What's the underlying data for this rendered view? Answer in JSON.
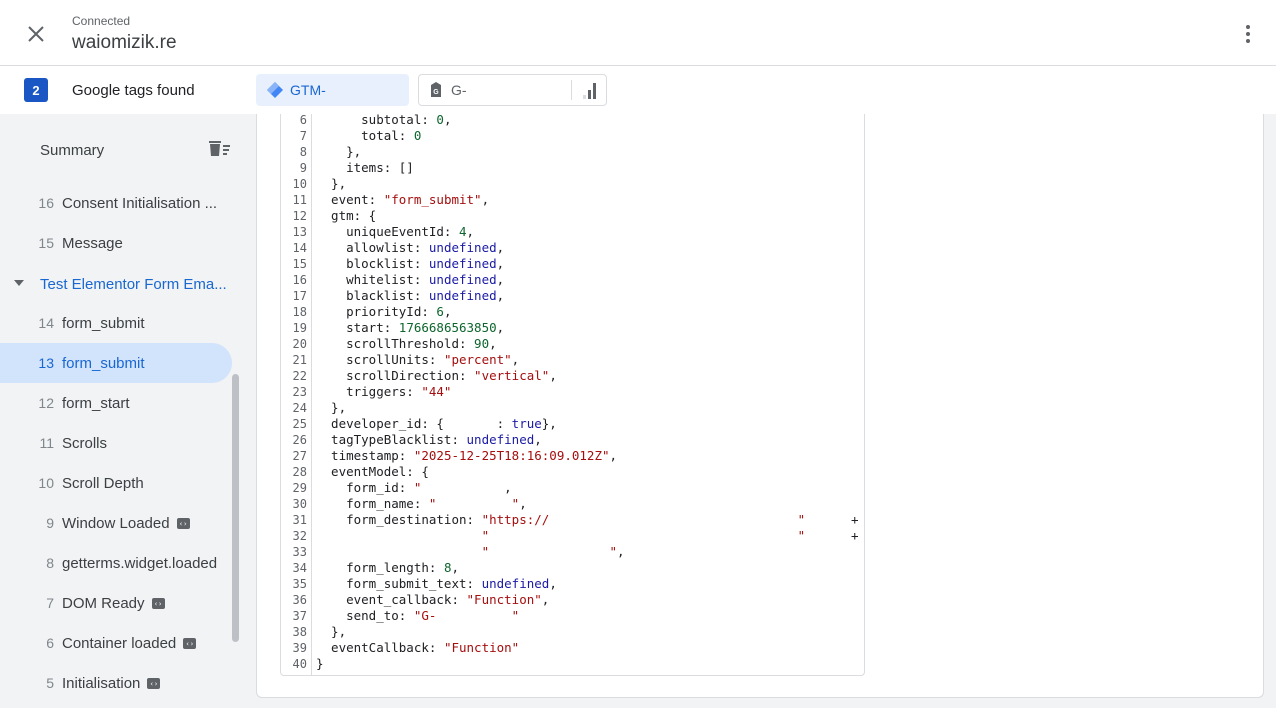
{
  "header": {
    "status": "Connected",
    "domain": "waiomizik.re"
  },
  "tags_bar": {
    "count": "2",
    "label": "Google tags found",
    "tags": [
      {
        "id_text": "GTM-",
        "type": "gtm",
        "selected": true
      },
      {
        "id_text": "G-",
        "type": "ga4",
        "selected": false
      }
    ]
  },
  "sidebar": {
    "summary_label": "Summary",
    "items": [
      {
        "num": "16",
        "label": "Consent Initialisation ..."
      },
      {
        "num": "15",
        "label": "Message"
      }
    ],
    "group": {
      "label": "Test Elementor Form Ema...",
      "expanded": true
    },
    "group_items": [
      {
        "num": "14",
        "label": "form_submit",
        "selected": false,
        "badge": false
      },
      {
        "num": "13",
        "label": "form_submit",
        "selected": true,
        "badge": false
      },
      {
        "num": "12",
        "label": "form_start",
        "selected": false,
        "badge": false
      },
      {
        "num": "11",
        "label": "Scrolls",
        "selected": false,
        "badge": false
      },
      {
        "num": "10",
        "label": "Scroll Depth",
        "selected": false,
        "badge": false
      },
      {
        "num": "9",
        "label": "Window Loaded",
        "selected": false,
        "badge": true
      },
      {
        "num": "8",
        "label": "getterms.widget.loaded",
        "selected": false,
        "badge": false
      },
      {
        "num": "7",
        "label": "DOM Ready",
        "selected": false,
        "badge": true
      },
      {
        "num": "6",
        "label": "Container loaded",
        "selected": false,
        "badge": true
      },
      {
        "num": "5",
        "label": "Initialisation",
        "selected": false,
        "badge": true
      }
    ]
  },
  "code": {
    "lines": [
      {
        "n": "6",
        "t": [
          [
            "      subtotal: ",
            ""
          ],
          [
            "0",
            "n"
          ],
          [
            ",",
            ""
          ]
        ]
      },
      {
        "n": "7",
        "t": [
          [
            "      total: ",
            ""
          ],
          [
            "0",
            "n"
          ]
        ]
      },
      {
        "n": "8",
        "t": [
          [
            "    },",
            ""
          ]
        ]
      },
      {
        "n": "9",
        "t": [
          [
            "    items: []",
            ""
          ]
        ]
      },
      {
        "n": "10",
        "t": [
          [
            "  },",
            ""
          ]
        ]
      },
      {
        "n": "11",
        "t": [
          [
            "  event: ",
            ""
          ],
          [
            "\"form_submit\"",
            "s"
          ],
          [
            ",",
            ""
          ]
        ]
      },
      {
        "n": "12",
        "t": [
          [
            "  gtm: {",
            ""
          ]
        ]
      },
      {
        "n": "13",
        "t": [
          [
            "    uniqueEventId: ",
            ""
          ],
          [
            "4",
            "n"
          ],
          [
            ",",
            ""
          ]
        ]
      },
      {
        "n": "14",
        "t": [
          [
            "    allowlist: ",
            ""
          ],
          [
            "undefined",
            "k"
          ],
          [
            ",",
            ""
          ]
        ]
      },
      {
        "n": "15",
        "t": [
          [
            "    blocklist: ",
            ""
          ],
          [
            "undefined",
            "k"
          ],
          [
            ",",
            ""
          ]
        ]
      },
      {
        "n": "16",
        "t": [
          [
            "    whitelist: ",
            ""
          ],
          [
            "undefined",
            "k"
          ],
          [
            ",",
            ""
          ]
        ]
      },
      {
        "n": "17",
        "t": [
          [
            "    blacklist: ",
            ""
          ],
          [
            "undefined",
            "k"
          ],
          [
            ",",
            ""
          ]
        ]
      },
      {
        "n": "18",
        "t": [
          [
            "    priorityId: ",
            ""
          ],
          [
            "6",
            "n"
          ],
          [
            ",",
            ""
          ]
        ]
      },
      {
        "n": "19",
        "t": [
          [
            "    start: ",
            ""
          ],
          [
            "1766686563850",
            "n"
          ],
          [
            ",",
            ""
          ]
        ]
      },
      {
        "n": "20",
        "t": [
          [
            "    scrollThreshold: ",
            ""
          ],
          [
            "90",
            "n"
          ],
          [
            ",",
            ""
          ]
        ]
      },
      {
        "n": "21",
        "t": [
          [
            "    scrollUnits: ",
            ""
          ],
          [
            "\"percent\"",
            "s"
          ],
          [
            ",",
            ""
          ]
        ]
      },
      {
        "n": "22",
        "t": [
          [
            "    scrollDirection: ",
            ""
          ],
          [
            "\"vertical\"",
            "s"
          ],
          [
            ",",
            ""
          ]
        ]
      },
      {
        "n": "23",
        "t": [
          [
            "    triggers: ",
            ""
          ],
          [
            "\"44\"",
            "s"
          ]
        ]
      },
      {
        "n": "24",
        "t": [
          [
            "  },",
            ""
          ]
        ]
      },
      {
        "n": "25",
        "t": [
          [
            "  developer_id: {       : ",
            ""
          ],
          [
            "true",
            "k"
          ],
          [
            "},",
            ""
          ]
        ]
      },
      {
        "n": "26",
        "t": [
          [
            "  tagTypeBlacklist: ",
            ""
          ],
          [
            "undefined",
            "k"
          ],
          [
            ",",
            ""
          ]
        ]
      },
      {
        "n": "27",
        "t": [
          [
            "  timestamp: ",
            ""
          ],
          [
            "\"2025-12-25T18:16:09.012Z\"",
            "s"
          ],
          [
            ",",
            ""
          ]
        ]
      },
      {
        "n": "28",
        "t": [
          [
            "  eventModel: {",
            ""
          ]
        ]
      },
      {
        "n": "29",
        "t": [
          [
            "    form_id: ",
            ""
          ],
          [
            "\"",
            "s"
          ],
          [
            "           ,",
            ""
          ]
        ]
      },
      {
        "n": "30",
        "t": [
          [
            "    form_name: ",
            ""
          ],
          [
            "\"          \"",
            "s"
          ],
          [
            ",",
            ""
          ]
        ]
      },
      {
        "n": "31",
        "t": [
          [
            "    form_destination: ",
            ""
          ],
          [
            "\"https://                                 \"",
            "s"
          ]
        ],
        "plus": true
      },
      {
        "n": "32",
        "t": [
          [
            "                      ",
            ""
          ],
          [
            "\"                                         \"",
            "s"
          ]
        ],
        "plus": true
      },
      {
        "n": "33",
        "t": [
          [
            "                      ",
            ""
          ],
          [
            "\"                \"",
            "s"
          ],
          [
            ",",
            ""
          ]
        ]
      },
      {
        "n": "34",
        "t": [
          [
            "    form_length: ",
            ""
          ],
          [
            "8",
            "n"
          ],
          [
            ",",
            ""
          ]
        ]
      },
      {
        "n": "35",
        "t": [
          [
            "    form_submit_text: ",
            ""
          ],
          [
            "undefined",
            "k"
          ],
          [
            ",",
            ""
          ]
        ]
      },
      {
        "n": "36",
        "t": [
          [
            "    event_callback: ",
            ""
          ],
          [
            "\"Function\"",
            "s"
          ],
          [
            ",",
            ""
          ]
        ]
      },
      {
        "n": "37",
        "t": [
          [
            "    send_to: ",
            ""
          ],
          [
            "\"G-          \"",
            "s"
          ]
        ]
      },
      {
        "n": "38",
        "t": [
          [
            "  },",
            ""
          ]
        ]
      },
      {
        "n": "39",
        "t": [
          [
            "  eventCallback: ",
            ""
          ],
          [
            "\"Function\"",
            "s"
          ]
        ]
      },
      {
        "n": "40",
        "t": [
          [
            "}",
            ""
          ]
        ]
      }
    ]
  }
}
